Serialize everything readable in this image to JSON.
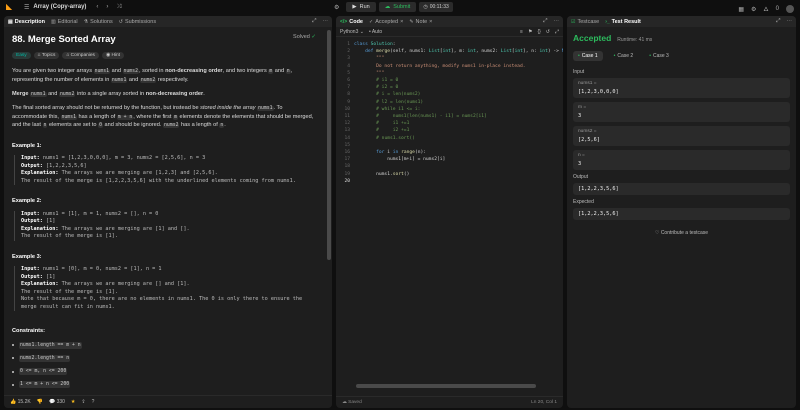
{
  "topbar": {
    "title": "Array (Copy-array)",
    "run_label": "Run",
    "submit_label": "Submit",
    "timer": "00:11:33",
    "notif_count": "0"
  },
  "description_panel": {
    "tabs": [
      {
        "label": "Description",
        "icon": "document-icon"
      },
      {
        "label": "Editorial",
        "icon": "book-icon"
      },
      {
        "label": "Solutions",
        "icon": "flask-icon"
      },
      {
        "label": "Submissions",
        "icon": "history-icon"
      }
    ],
    "problem_title": "88. Merge Sorted Array",
    "solved_label": "Solved",
    "badges": [
      "Easy",
      "Topics",
      "Companies",
      "Hint"
    ],
    "para1": {
      "a": "You are given two integer arrays",
      "c1": "nums1",
      "b": "and",
      "c2": "nums2",
      "c": ", sorted in",
      "bold": "non-decreasing order",
      "d": ", and two integers",
      "c3": "m",
      "e": "and",
      "c4": "n",
      "f": ", representing the number of elements in",
      "c5": "nums1",
      "g": "and",
      "c6": "nums2",
      "h": "respectively."
    },
    "para2": {
      "bold1": "Merge",
      "c1": "nums1",
      "a": "and",
      "c2": "nums2",
      "b": "into a single array sorted in",
      "bold2": "non-decreasing order",
      "c": "."
    },
    "para3": {
      "a": "The final sorted array should not be returned by the function, but instead be",
      "ital": "stored inside the array",
      "c1": "nums1",
      "b": ". To accommodate this,",
      "c2": "nums1",
      "c": "has a length of",
      "c3": "m + n",
      "d": ", where the first",
      "c4": "m",
      "e": "elements denote the elements that should be merged, and the last",
      "c5": "n",
      "f": "elements are set to",
      "c6": "0",
      "g": "and should be ignored.",
      "c7": "nums2",
      "h": "has a length of",
      "c8": "n",
      "i": "."
    },
    "examples": [
      {
        "heading": "Example 1:",
        "input_label": "Input:",
        "input": "nums1 = [1,2,3,0,0,0], m = 3, nums2 = [2,5,6], n = 3",
        "output_label": "Output:",
        "output": "[1,2,2,3,5,6]",
        "expl_label": "Explanation:",
        "expl": "The arrays we are merging are [1,2,3] and [2,5,6].",
        "extra": [
          "The result of the merge is [1,2,2,3,5,6] with the underlined elements coming from nums1."
        ]
      },
      {
        "heading": "Example 2:",
        "input_label": "Input:",
        "input": "nums1 = [1], m = 1, nums2 = [], n = 0",
        "output_label": "Output:",
        "output": "[1]",
        "expl_label": "Explanation:",
        "expl": "The arrays we are merging are [1] and [].",
        "extra": [
          "The result of the merge is [1]."
        ]
      },
      {
        "heading": "Example 3:",
        "input_label": "Input:",
        "input": "nums1 = [0], m = 0, nums2 = [1], n = 1",
        "output_label": "Output:",
        "output": "[1]",
        "expl_label": "Explanation:",
        "expl": "The arrays we are merging are [] and [1].",
        "extra": [
          "The result of the merge is [1].",
          "Note that because m = 0, there are no elements in nums1. The 0 is only there to ensure the",
          "merge result can fit in nums1."
        ]
      }
    ],
    "constraints_heading": "Constraints:",
    "constraints": [
      "nums1.length == m + n",
      "nums2.length == n",
      "0 <= m, n <= 200",
      "1 <= m + n <= 200"
    ],
    "footer": {
      "likes": "15.2K",
      "comments": "330"
    }
  },
  "code_panel": {
    "tabs": [
      {
        "label": "Code",
        "icon": "code-icon"
      },
      {
        "label": "Accepted",
        "icon": "check-icon"
      },
      {
        "label": "Note",
        "icon": "note-icon"
      }
    ],
    "language": "Python3",
    "autocomplete": "Auto",
    "line_count": 20,
    "status": "Saved",
    "cursor": "Ln 20, Col 1"
  },
  "result_panel": {
    "tabs": [
      {
        "label": "Testcase",
        "icon": "checkbox-icon"
      },
      {
        "label": "Test Result",
        "icon": "terminal-icon"
      }
    ],
    "status": "Accepted",
    "runtime": "Runtime: 41 ms",
    "cases": [
      "Case 1",
      "Case 2",
      "Case 3"
    ],
    "input_label": "Input",
    "inputs": [
      {
        "name": "nums1 =",
        "value": "[1,2,3,0,0,0]"
      },
      {
        "name": "m =",
        "value": "3"
      },
      {
        "name": "nums2 =",
        "value": "[2,5,6]"
      },
      {
        "name": "n =",
        "value": "3"
      }
    ],
    "output_label": "Output",
    "output": "[1,2,2,3,5,6]",
    "expected_label": "Expected",
    "expected": "[1,2,2,3,5,6]",
    "contribute": "Contribute a testcase"
  },
  "colors": {
    "accent": "#ffa116",
    "success": "#2cbb5d",
    "easy": "#00b8a3"
  }
}
